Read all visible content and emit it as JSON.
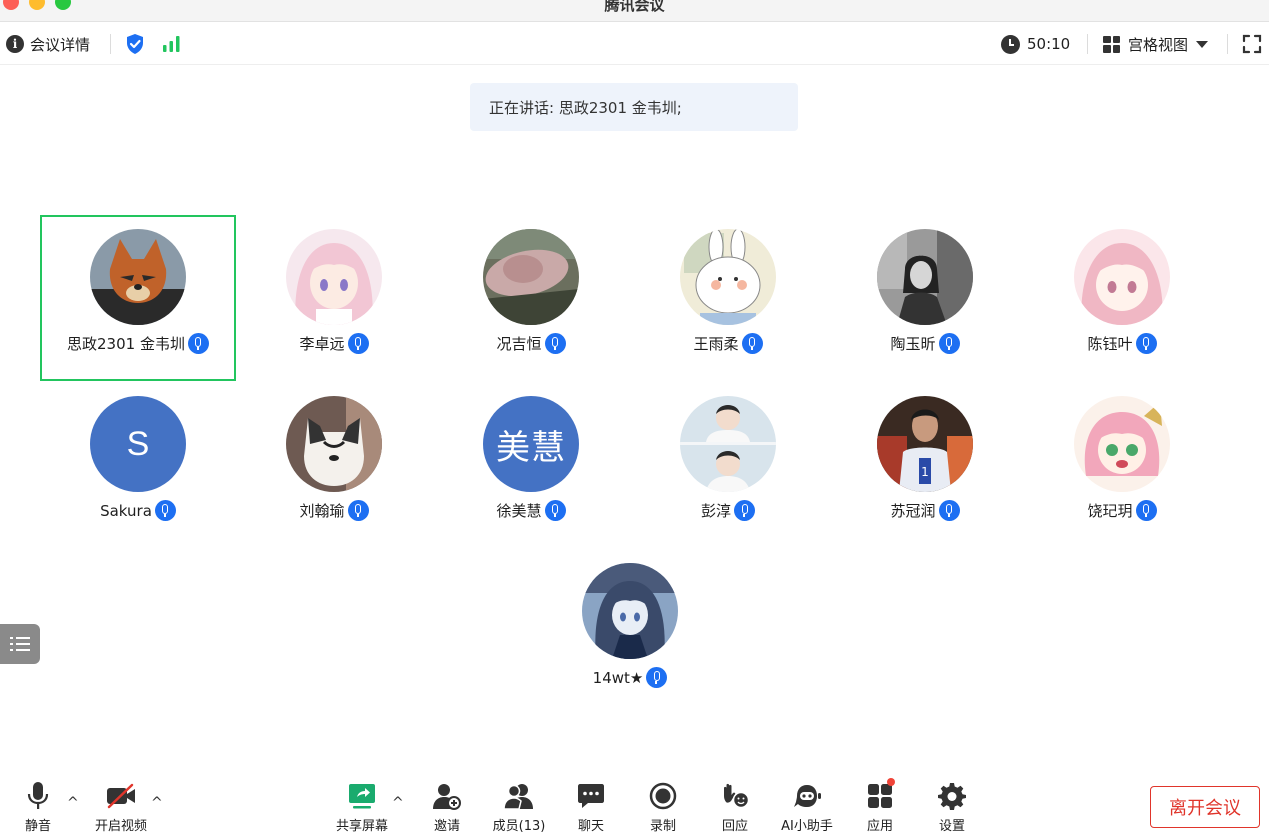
{
  "window": {
    "title": "腾讯会议"
  },
  "topbar": {
    "meeting_info_label": "会议详情",
    "timer": "50:10",
    "view_label": "宫格视图"
  },
  "speaking": {
    "text": "正在讲话: 思政2301 金韦圳;"
  },
  "participants": [
    {
      "name": "思政2301 金韦圳",
      "avatar": "fox",
      "active": true
    },
    {
      "name": "李卓远",
      "avatar": "anime-girl-pink"
    },
    {
      "name": "况吉恒",
      "avatar": "photo-hat"
    },
    {
      "name": "王雨柔",
      "avatar": "bunny-cartoon"
    },
    {
      "name": "陶玉昕",
      "avatar": "photo-bw-girl"
    },
    {
      "name": "陈钰叶",
      "avatar": "anime-girl-light"
    },
    {
      "name": "Sakura",
      "avatar_letter": "S",
      "avatar_color": "#4472c4"
    },
    {
      "name": "刘翰瑜",
      "avatar": "photo-cat"
    },
    {
      "name": "徐美慧",
      "avatar_text": "美慧",
      "avatar_color": "#4472c4"
    },
    {
      "name": "彭淳",
      "avatar": "photo-boy"
    },
    {
      "name": "苏冠润",
      "avatar": "photo-player"
    },
    {
      "name": "饶玘玥",
      "avatar": "anime-girl-anya"
    },
    {
      "name": "14wt★",
      "avatar": "anime-girl-dark"
    }
  ],
  "toolbar": {
    "mute_label": "静音",
    "video_label": "开启视频",
    "share_label": "共享屏幕",
    "invite_label": "邀请",
    "members_label": "成员(13)",
    "chat_label": "聊天",
    "record_label": "录制",
    "reaction_label": "回应",
    "ai_label": "AI小助手",
    "apps_label": "应用",
    "settings_label": "设置",
    "leave_label": "离开会议"
  },
  "colors": {
    "active_border": "#22c55e",
    "mic_badge": "#1d6ff2",
    "leave": "#e0352b",
    "share_icon": "#1aab6e"
  }
}
